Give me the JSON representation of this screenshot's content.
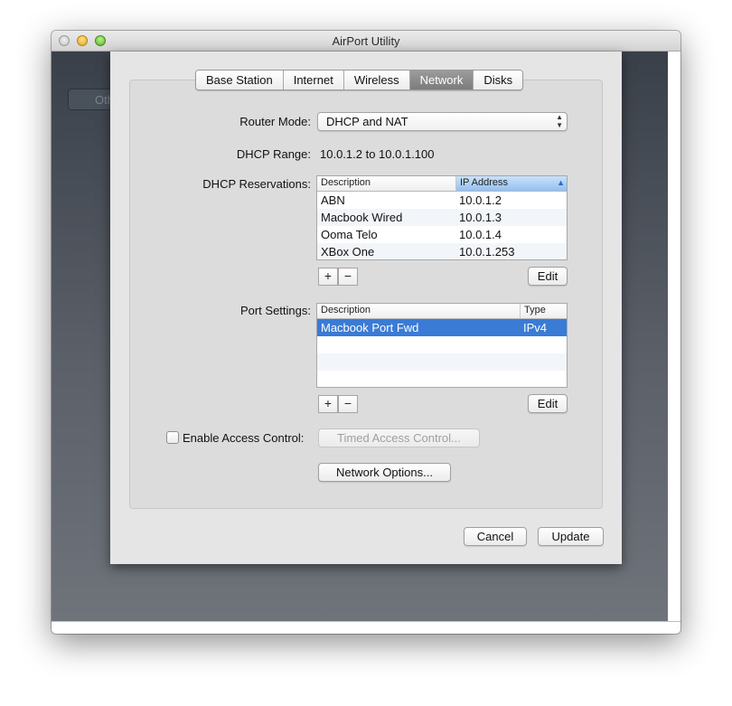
{
  "window": {
    "title": "AirPort Utility"
  },
  "background": {
    "button_label": "Other Wi-Fi Devices"
  },
  "tabs": [
    {
      "label": "Base Station",
      "active": false
    },
    {
      "label": "Internet",
      "active": false
    },
    {
      "label": "Wireless",
      "active": false
    },
    {
      "label": "Network",
      "active": true
    },
    {
      "label": "Disks",
      "active": false
    }
  ],
  "router_mode": {
    "label": "Router Mode:",
    "value": "DHCP and NAT"
  },
  "dhcp_range": {
    "label": "DHCP Range:",
    "value": "10.0.1.2 to 10.0.1.100"
  },
  "dhcp_reservations": {
    "label": "DHCP Reservations:",
    "columns": [
      "Description",
      "IP Address"
    ],
    "sorted_column": "IP Address",
    "rows": [
      {
        "description": "ABN",
        "ip": "10.0.1.2"
      },
      {
        "description": "Macbook Wired",
        "ip": "10.0.1.3"
      },
      {
        "description": "Ooma Telo",
        "ip": "10.0.1.4"
      },
      {
        "description": "XBox One",
        "ip": "10.0.1.253"
      }
    ],
    "add_label": "+",
    "remove_label": "−",
    "edit_label": "Edit"
  },
  "port_settings": {
    "label": "Port Settings:",
    "columns": [
      "Description",
      "Type"
    ],
    "rows": [
      {
        "description": "Macbook Port Fwd",
        "type": "IPv4",
        "selected": true
      }
    ],
    "add_label": "+",
    "remove_label": "−",
    "edit_label": "Edit"
  },
  "access_control": {
    "checkbox_label": "Enable Access Control:",
    "checked": false,
    "timed_button_label": "Timed Access Control..."
  },
  "network_options_label": "Network Options...",
  "footer": {
    "cancel_label": "Cancel",
    "update_label": "Update"
  },
  "colors": {
    "selection": "#3a7bd5",
    "active_tab": "#8a8a8a",
    "background_dark": "#3a4049"
  }
}
